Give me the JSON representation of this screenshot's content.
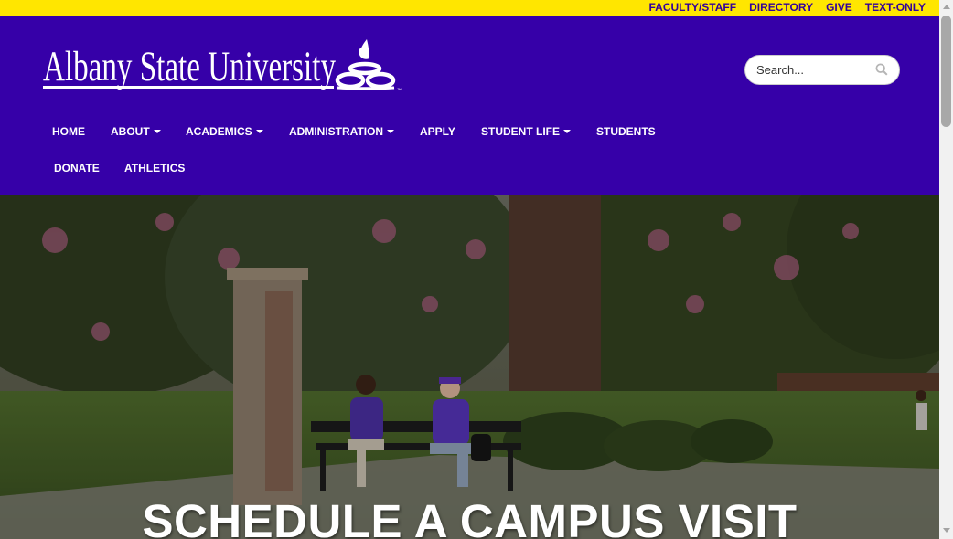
{
  "utility_links": [
    "FACULTY/STAFF",
    "DIRECTORY",
    "GIVE",
    "TEXT-ONLY"
  ],
  "logo": {
    "text": "Albany State University",
    "tm": "™",
    "icon": "university-flame-emblem"
  },
  "search": {
    "placeholder": "Search...",
    "icon": "search-icon"
  },
  "nav": {
    "row1": [
      {
        "label": "HOME",
        "dropdown": false
      },
      {
        "label": "ABOUT",
        "dropdown": true
      },
      {
        "label": "ACADEMICS",
        "dropdown": true
      },
      {
        "label": "ADMINISTRATION",
        "dropdown": true
      },
      {
        "label": "APPLY",
        "dropdown": false
      },
      {
        "label": "STUDENT LIFE",
        "dropdown": true
      },
      {
        "label": "STUDENTS",
        "dropdown": false
      }
    ],
    "row2": [
      {
        "label": "DONATE",
        "dropdown": false
      },
      {
        "label": "ATHLETICS",
        "dropdown": false
      }
    ]
  },
  "hero": {
    "title": "SCHEDULE A CAMPUS VISIT"
  },
  "colors": {
    "topbar": "#ffe600",
    "header": "#3600a8",
    "utility_text": "#33009a"
  }
}
